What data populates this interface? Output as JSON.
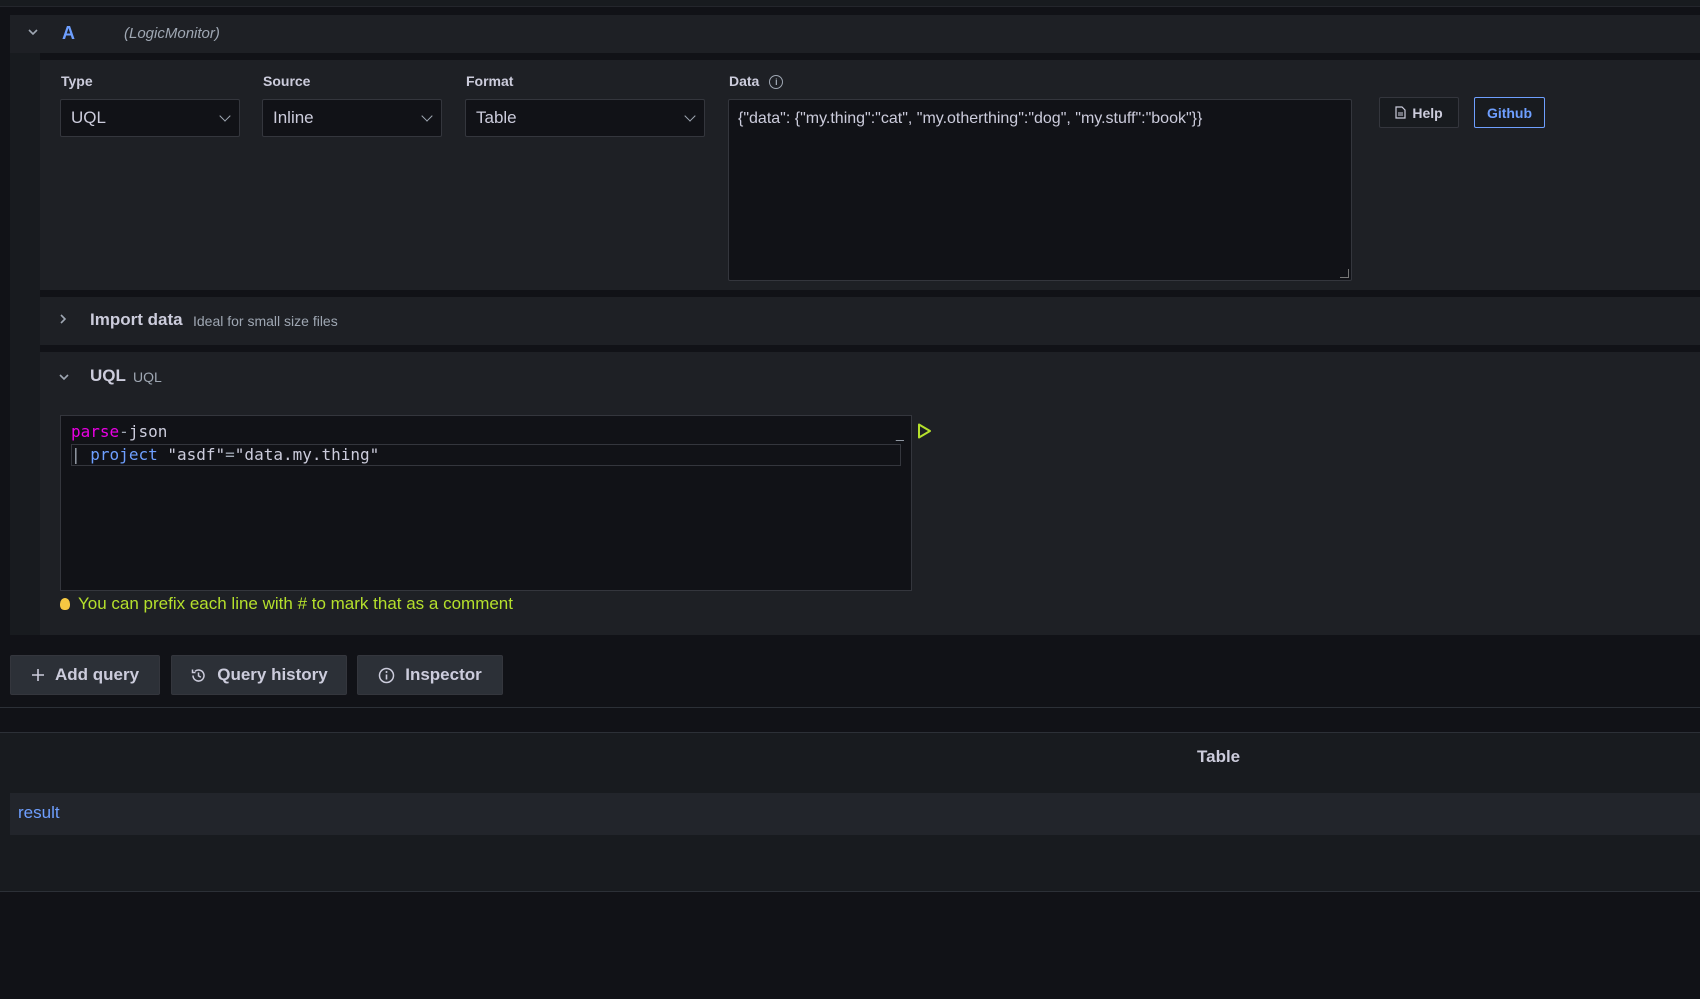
{
  "query": {
    "ref_id": "A",
    "datasource": "(LogicMonitor)"
  },
  "fields": {
    "type": {
      "label": "Type",
      "value": "UQL"
    },
    "source": {
      "label": "Source",
      "value": "Inline"
    },
    "format": {
      "label": "Format",
      "value": "Table"
    },
    "data": {
      "label": "Data",
      "value": "{\"data\": {\"my.thing\":\"cat\", \"my.otherthing\":\"dog\", \"my.stuff\":\"book\"}}"
    }
  },
  "buttons": {
    "help": "Help",
    "github": "Github",
    "add_query": "Add query",
    "query_history": "Query history",
    "inspector": "Inspector"
  },
  "import_section": {
    "title": "Import data",
    "subtitle": "Ideal for small size files"
  },
  "uql_section": {
    "title": "UQL",
    "subtitle": "UQL",
    "line1_kw": "parse",
    "line1_op": "-",
    "line1_rest": "json",
    "line2_pipe": "|",
    "line2_kw": "project",
    "line2_a": "\"asdf\"",
    "line2_eq": "=",
    "line2_b": "\"data.my.thing\"",
    "hint": "You can prefix each line with # to mark that as a comment"
  },
  "table_panel": {
    "title": "Table",
    "result_label": "result"
  },
  "colors": {
    "background": "#111217",
    "panel": "#1e2025",
    "accent_blue": "#6e9fff",
    "hint_green": "#b5e02c",
    "keyword_magenta": "#ea00e4"
  }
}
